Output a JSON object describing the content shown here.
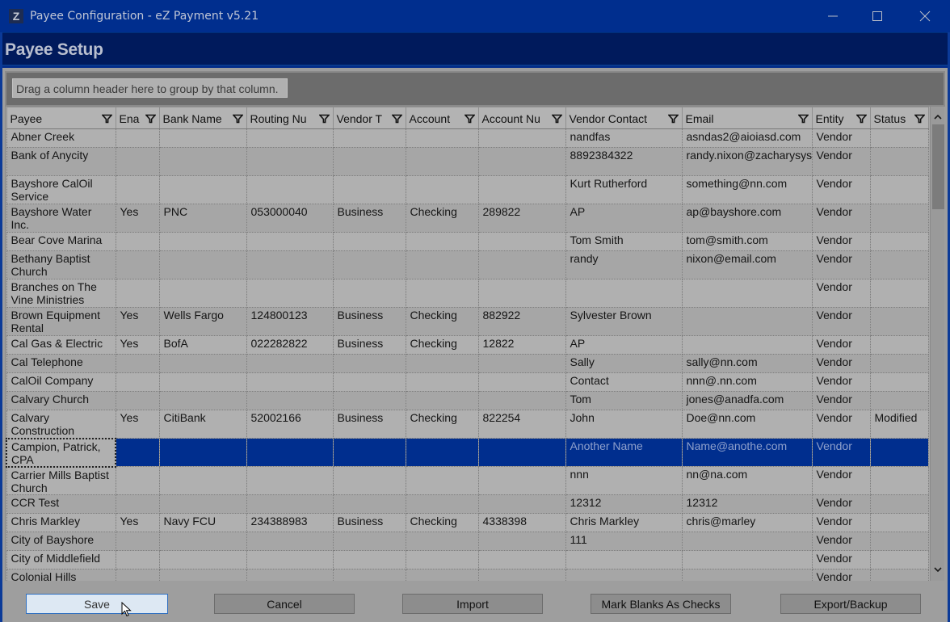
{
  "window": {
    "logo": "Z",
    "title": "Payee Configuration - eZ Payment v5.21",
    "controls": {
      "minimize": "minimize-icon",
      "maximize": "maximize-icon",
      "close": "close-icon"
    }
  },
  "header": {
    "title": "Payee Setup"
  },
  "group_panel": {
    "hint": "Drag a column header here to group by that column."
  },
  "grid": {
    "columns": [
      {
        "label": "Payee",
        "icon": "filter-icon"
      },
      {
        "label": "Ena",
        "icon": "filter-icon"
      },
      {
        "label": "Bank Name",
        "icon": "filter-icon"
      },
      {
        "label": "Routing Nu",
        "icon": "filter-icon"
      },
      {
        "label": "Vendor T",
        "icon": "filter-icon"
      },
      {
        "label": "Account",
        "icon": "filter-icon"
      },
      {
        "label": "Account Nu",
        "icon": "filter-icon"
      },
      {
        "label": "Vendor Contact",
        "icon": "filter-icon"
      },
      {
        "label": "Email",
        "icon": "filter-icon"
      },
      {
        "label": "Entity",
        "icon": "filter-icon"
      },
      {
        "label": "Status",
        "icon": "filter-icon"
      }
    ],
    "rows": [
      [
        "Abner Creek",
        "",
        "",
        "",
        "",
        "",
        "",
        "nandfas",
        "asndas2@aioiasd.com",
        "Vendor",
        ""
      ],
      [
        "Bank of Anycity",
        "",
        "",
        "",
        "",
        "",
        "",
        "8892384322",
        "randy.nixon@zacharysystems.com",
        "Vendor",
        ""
      ],
      [
        "Bayshore CalOil Service",
        "",
        "",
        "",
        "",
        "",
        "",
        "Kurt Rutherford",
        "something@nn.com",
        "Vendor",
        ""
      ],
      [
        "Bayshore Water Inc.",
        "Yes",
        "PNC",
        "053000040",
        "Business",
        "Checking",
        "289822",
        "AP",
        "ap@bayshore.com",
        "Vendor",
        ""
      ],
      [
        "Bear Cove Marina",
        "",
        "",
        "",
        "",
        "",
        "",
        "Tom Smith",
        "tom@smith.com",
        "Vendor",
        ""
      ],
      [
        "Bethany Baptist Church",
        "",
        "",
        "",
        "",
        "",
        "",
        "randy",
        "nixon@email.com",
        "Vendor",
        ""
      ],
      [
        "Branches on The Vine Ministries",
        "",
        "",
        "",
        "",
        "",
        "",
        "",
        "",
        "Vendor",
        ""
      ],
      [
        "Brown Equipment Rental",
        "Yes",
        "Wells Fargo",
        "124800123",
        "Business",
        "Checking",
        "882922",
        "Sylvester Brown",
        "",
        "Vendor",
        ""
      ],
      [
        "Cal Gas & Electric",
        "Yes",
        "BofA",
        "022282822",
        "Business",
        "Checking",
        "12822",
        "AP",
        "",
        "Vendor",
        ""
      ],
      [
        "Cal Telephone",
        "",
        "",
        "",
        "",
        "",
        "",
        "Sally",
        "sally@nn.com",
        "Vendor",
        ""
      ],
      [
        "CalOil Company",
        "",
        "",
        "",
        "",
        "",
        "",
        "Contact",
        "nnn@.nn.com",
        "Vendor",
        ""
      ],
      [
        "Calvary Church",
        "",
        "",
        "",
        "",
        "",
        "",
        "Tom",
        "jones@anadfa.com",
        "Vendor",
        ""
      ],
      [
        "Calvary Construction",
        "Yes",
        "CitiBank",
        "52002166",
        "Business",
        "Checking",
        "822254",
        "John",
        "Doe@nn.com",
        "Vendor",
        "Modified"
      ],
      [
        "Campion, Patrick, CPA",
        "",
        "",
        "",
        "",
        "",
        "",
        "Another Name",
        "Name@anothe.com",
        "Vendor",
        ""
      ],
      [
        "Carrier Mills Baptist Church",
        "",
        "",
        "",
        "",
        "",
        "",
        "nnn",
        "nn@na.com",
        "Vendor",
        ""
      ],
      [
        "CCR Test",
        "",
        "",
        "",
        "",
        "",
        "",
        "12312",
        "12312",
        "Vendor",
        ""
      ],
      [
        "Chris Markley",
        "Yes",
        "Navy FCU",
        "234388983",
        "Business",
        "Checking",
        "4338398",
        "Chris Markley",
        "chris@marley",
        "Vendor",
        ""
      ],
      [
        "City of Bayshore",
        "",
        "",
        "",
        "",
        "",
        "",
        "111",
        "",
        "Vendor",
        ""
      ],
      [
        "City of Middlefield",
        "",
        "",
        "",
        "",
        "",
        "",
        "",
        "",
        "Vendor",
        ""
      ],
      [
        "Colonial Hills",
        "",
        "",
        "",
        "",
        "",
        "",
        "",
        "",
        "Vendor",
        ""
      ]
    ],
    "selected_row": 13
  },
  "buttons": {
    "save": "Save",
    "cancel": "Cancel",
    "import": "Import",
    "mark_blanks": "Mark Blanks As Checks",
    "export": "Export/Backup"
  },
  "colors": {
    "titlebar": "#002e8e",
    "header": "#001a5c",
    "selection": "#002e8e",
    "grid_bg": "#a8a8a8"
  }
}
